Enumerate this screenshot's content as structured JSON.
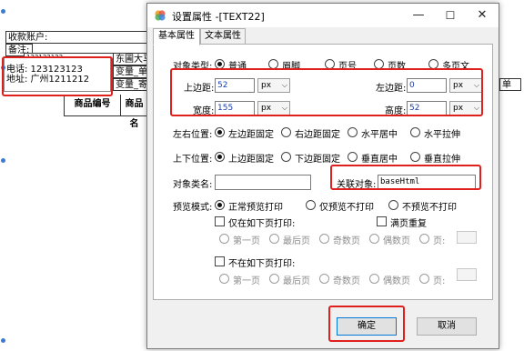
{
  "background": {
    "account_label": "收款账户:",
    "remark_label": "备注:",
    "phone_line": "电话: 123123123",
    "address_line": "地址: 广州1211212",
    "cell_digits": "123123123",
    "cell_dongpu": "东圃大马",
    "cell_var1": "变量_单:",
    "cell_var2": "变量_寄:",
    "cell_right": "单",
    "header_col1": "商品编号",
    "header_col2": "商品名"
  },
  "dialog": {
    "title": "设置属性 -[TEXT22]",
    "minimize_glyph": "—",
    "maximize_glyph": "☐",
    "close_glyph": "✕",
    "tabs": [
      {
        "label": "基本属性"
      },
      {
        "label": "文本属性"
      }
    ],
    "object_type": {
      "label": "对象类型:",
      "options": [
        "普通",
        "眉脚",
        "页号",
        "页数",
        "多页文"
      ]
    },
    "top_margin": {
      "label": "上边距:",
      "value": "52",
      "unit": "px"
    },
    "left_margin": {
      "label": "左边距:",
      "value": "0",
      "unit": "px"
    },
    "width": {
      "label": "宽度:",
      "value": "155",
      "unit": "px"
    },
    "height": {
      "label": "高度:",
      "value": "52",
      "unit": "px"
    },
    "horizontal_position": {
      "label": "左右位置:",
      "options": [
        "左边距固定",
        "右边距固定",
        "水平居中",
        "水平拉伸"
      ]
    },
    "vertical_position": {
      "label": "上下位置:",
      "options": [
        "上边距固定",
        "下边距固定",
        "垂直居中",
        "垂直拉伸"
      ]
    },
    "object_class": {
      "label": "对象类名:",
      "value": ""
    },
    "linked_object": {
      "label": "关联对象:",
      "value": "baseHtml"
    },
    "preview_mode": {
      "label": "预览模式:",
      "options": [
        "正常预览打印",
        "仅预览不打印",
        "不预览不打印"
      ]
    },
    "print_only_on": {
      "label": "仅在如下页打印:",
      "options": [
        "第一页",
        "最后页",
        "奇数页",
        "偶数页",
        "页:"
      ]
    },
    "full_page_repeat": {
      "label": "满页重复"
    },
    "no_print_on": {
      "label": "不在如下页打印:",
      "options": [
        "第一页",
        "最后页",
        "奇数页",
        "偶数页",
        "页:"
      ]
    },
    "ok_label": "确定",
    "cancel_label": "取消"
  },
  "colors": {
    "highlight_red": "#e0201c",
    "input_value_blue": "#1a3fa8",
    "handle_blue": "#3a7bd5",
    "default_button_border": "#0078d7"
  }
}
